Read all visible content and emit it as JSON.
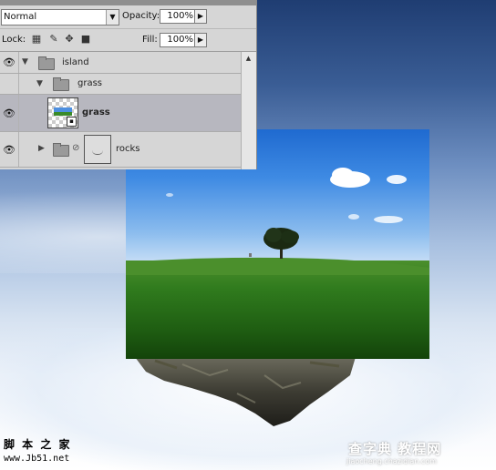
{
  "layers_panel": {
    "blend_mode": "Normal",
    "opacity_label": "Opacity:",
    "opacity_value": "100%",
    "lock_label": "Lock:",
    "fill_label": "Fill:",
    "fill_value": "100%",
    "layers": [
      {
        "name": "island",
        "type": "group",
        "expanded": true
      },
      {
        "name": "grass",
        "type": "group",
        "expanded": true
      },
      {
        "name": "grass",
        "type": "layer",
        "selected": true
      },
      {
        "name": "rocks",
        "type": "group",
        "expanded": false
      }
    ]
  },
  "icons": [
    "eye-icon",
    "folder-icon",
    "lock-transparent-icon",
    "brush-icon",
    "move-icon",
    "lock-all-icon",
    "link-icon",
    "mask-icon",
    "dropdown-arrow-icon",
    "scroll-up-icon"
  ],
  "watermarks": {
    "left_line1": "脚 本 之 家",
    "left_line2": "www.Jb51.net",
    "right_line1": "查字典 教程网",
    "right_line2": "jiaocheng.chazidian.com"
  },
  "colors": {
    "panel_bg": "#d6d6d6",
    "selected_row": "#b7b7bf",
    "sky_top": "#1f3d72",
    "grass": "#2f7a1d"
  }
}
